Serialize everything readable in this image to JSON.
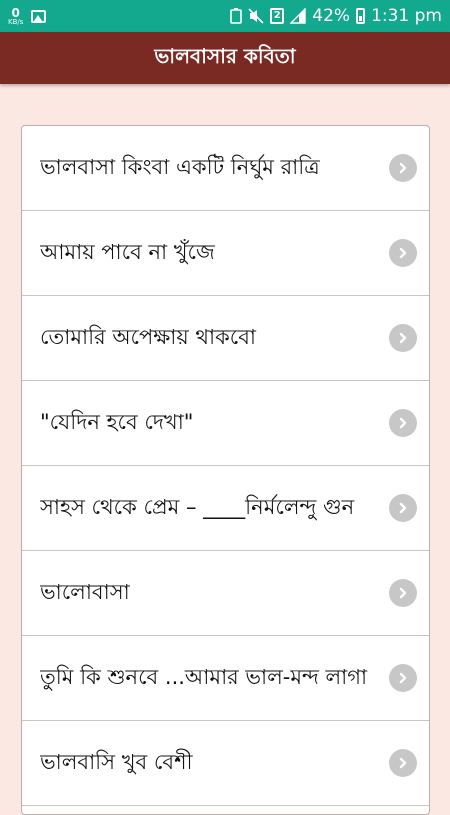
{
  "status_bar": {
    "net_speed": "0",
    "net_unit": "KB/s",
    "sim_number": "2",
    "battery_percent": "42%",
    "time": "1:31 pm",
    "icons": [
      "image-icon",
      "android-icon",
      "mute-icon",
      "sim-icon",
      "signal-icon",
      "battery-icon"
    ]
  },
  "app_bar": {
    "title": "ভালবাসার কবিতা"
  },
  "list": {
    "items": [
      {
        "label": "ভালবাসা কিংবা একটি নির্ঘুম রাত্রি"
      },
      {
        "label": "আমায় পাবে না খুঁজে"
      },
      {
        "label": "তোমারি অপেক্ষায় থাকবো"
      },
      {
        "label": "\"যেদিন হবে দেখা\""
      },
      {
        "label": "সাহস থেকে প্রেম – ____নির্মলেন্দু গুন"
      },
      {
        "label": "ভালোবাসা"
      },
      {
        "label": "তুমি কি শুনবে ...আমার ভাল-মন্দ লাগা"
      },
      {
        "label": "ভালবাসি খুব বেশী"
      }
    ],
    "arrow_icon": "chevron-right-circle-icon"
  },
  "colors": {
    "status_bar": "#12a98f",
    "app_bar": "#7a2a22",
    "background": "#fce8e2",
    "chevron": "#c7c7c7"
  }
}
